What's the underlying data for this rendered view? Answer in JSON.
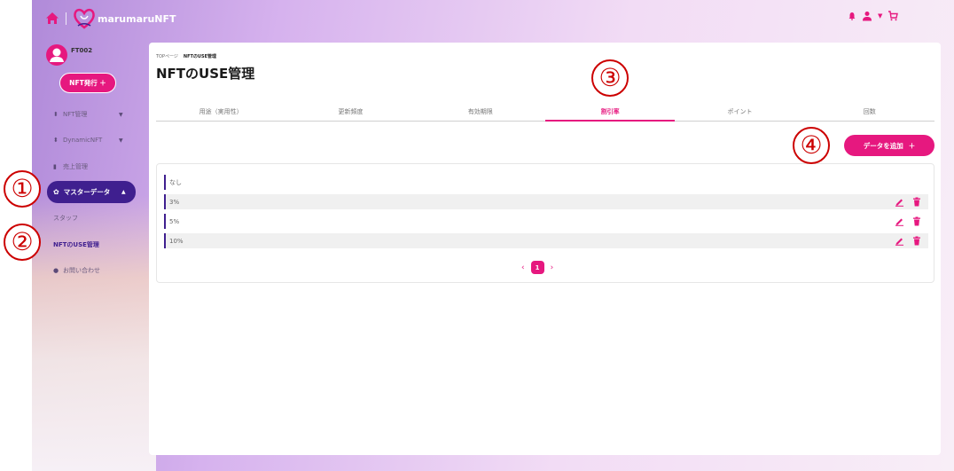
{
  "header": {
    "logo_text": "marumaruNFT"
  },
  "sidebar": {
    "user_name": "FT002",
    "nft_issue_label": "NFT発行 ＋",
    "items": [
      {
        "label": "NFT管理",
        "icon": "up-down-icon",
        "has_caret": true
      },
      {
        "label": "DynamicNFT",
        "icon": "up-down-icon",
        "has_caret": true
      },
      {
        "label": "売上管理",
        "icon": "bar-chart-icon",
        "has_caret": false
      }
    ],
    "active_item": {
      "label": "マスターデータ",
      "icon": "gear-icon"
    },
    "sub_items": [
      {
        "label": "スタッフ",
        "active": false
      },
      {
        "label": "NFTのUSE管理",
        "active": true
      }
    ],
    "contact": {
      "label": "お問い合わせ",
      "icon": "question-icon"
    }
  },
  "annotations": [
    "①",
    "②",
    "③",
    "④"
  ],
  "main": {
    "breadcrumb": [
      "TOPページ",
      "NFTのUSE管理"
    ],
    "title": "NFTのUSE管理",
    "tabs": [
      {
        "label": "用途（実用性）",
        "active": false
      },
      {
        "label": "更新頻度",
        "active": false
      },
      {
        "label": "有効期限",
        "active": false
      },
      {
        "label": "割引率",
        "active": true
      },
      {
        "label": "ポイント",
        "active": false
      },
      {
        "label": "回数",
        "active": false
      }
    ],
    "add_button": "データを追加",
    "add_button_icon": "＋",
    "rows": [
      {
        "label": "なし",
        "editable": false
      },
      {
        "label": "3%",
        "editable": true
      },
      {
        "label": "5%",
        "editable": true
      },
      {
        "label": "10%",
        "editable": true
      }
    ],
    "pagination": {
      "prev": "‹",
      "current": "1",
      "next": "›"
    }
  },
  "colors": {
    "accent": "#e6187f",
    "primary": "#3f1f8f"
  }
}
